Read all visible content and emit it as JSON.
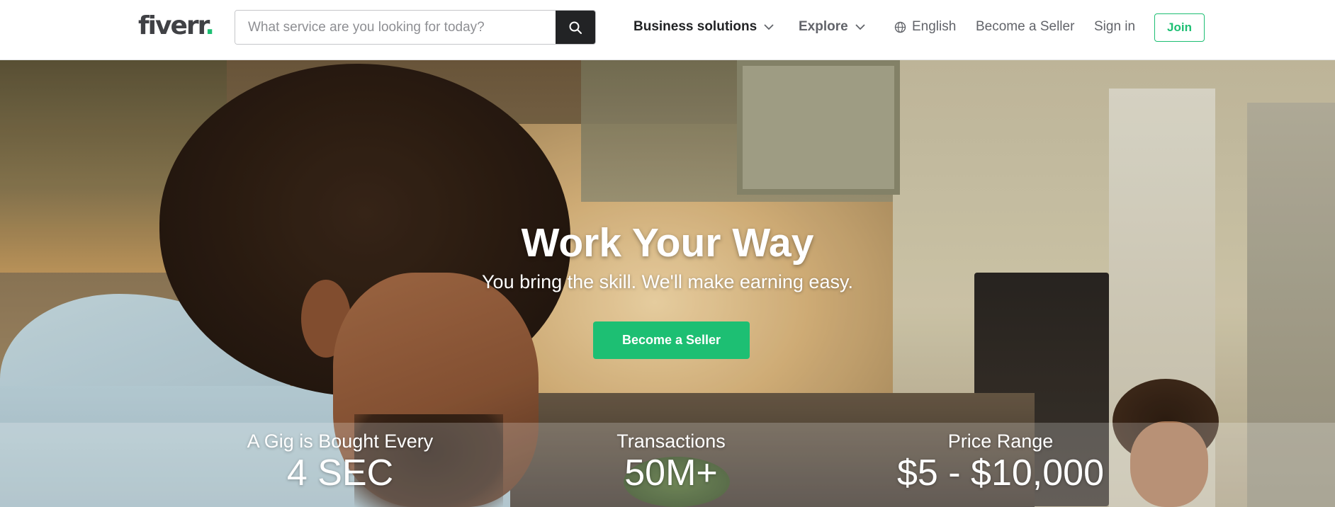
{
  "header": {
    "logo": {
      "text": "fiverr",
      "dot": "."
    },
    "search": {
      "placeholder": "What service are you looking for today?"
    },
    "nav": {
      "business_solutions": "Business solutions",
      "explore": "Explore",
      "language": "English",
      "become_seller": "Become a Seller",
      "sign_in": "Sign in",
      "join": "Join"
    }
  },
  "hero": {
    "title": "Work Your Way",
    "subtitle": "You bring the skill. We'll make earning easy.",
    "cta": "Become a Seller"
  },
  "stats": [
    {
      "label": "A Gig is Bought Every",
      "value": "4 SEC"
    },
    {
      "label": "Transactions",
      "value": "50M+"
    },
    {
      "label": "Price Range",
      "value": "$5 - $10,000"
    }
  ],
  "colors": {
    "brand_green": "#1dbf73",
    "dark": "#222325",
    "text_gray": "#62646a"
  },
  "icons": {
    "search": "search-icon",
    "chevron": "chevron-down-icon",
    "globe": "globe-icon"
  }
}
